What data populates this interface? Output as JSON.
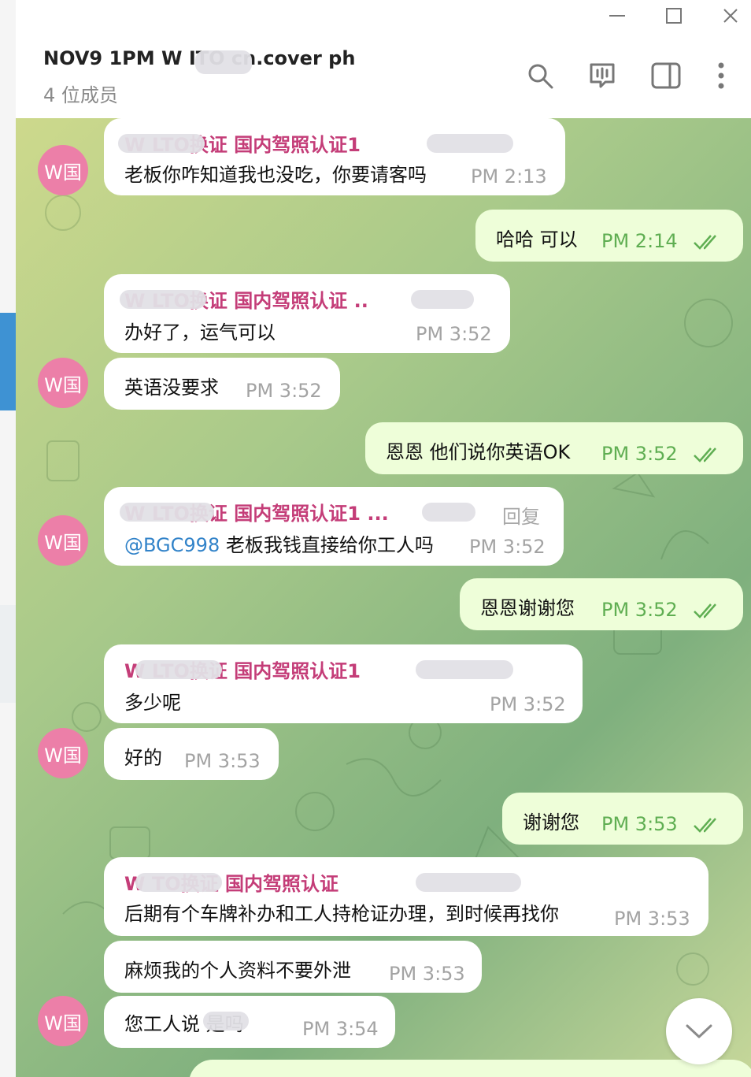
{
  "window": {
    "minimize": "—",
    "maximize": "☐",
    "close": "✕"
  },
  "header": {
    "title": "NOV9 1PM W      ITO cn.cover ph",
    "subtitle": "4 位成员",
    "icons": [
      "search-icon",
      "video-chat-icon",
      "sidebar-toggle-icon",
      "more-icon"
    ]
  },
  "avatar_label": "W国",
  "messages": [
    {
      "sender": "W         LTO换证 国内驾照认证1",
      "text": "老板你咋知道我也没吃，你要请客吗",
      "time": "PM 2:13"
    },
    {
      "text": "哈哈 可以",
      "time": "PM 2:14"
    },
    {
      "sender": "W          LTO换证 国内驾照认证       ..",
      "text": "办好了，运气可以",
      "time": "PM 3:52"
    },
    {
      "text": "英语没要求",
      "time": "PM 3:52"
    },
    {
      "text": "恩恩 他们说你英语OK",
      "time": "PM 3:52"
    },
    {
      "sender": "W         LTO换证 国内驾照认证1       ...",
      "reply_label": "回复",
      "mention": "@BGC998",
      "text": " 老板我钱直接给你工人吗",
      "time": "PM 3:52"
    },
    {
      "text": "恩恩谢谢您",
      "time": "PM 3:52"
    },
    {
      "sender": "W         LTO换证 国内驾照认证1",
      "text": "多少呢",
      "time": "PM 3:52"
    },
    {
      "text": "好的",
      "time": "PM 3:53"
    },
    {
      "text": "谢谢您",
      "time": "PM 3:53"
    },
    {
      "sender": "W         TO换证 国内驾照认证",
      "text": "后期有个车牌补办和工人持枪证办理，到时候再找你",
      "time": "PM 3:53"
    },
    {
      "text": "麻烦我的个人资料不要外泄",
      "time": "PM 3:53"
    },
    {
      "text": "您工人说       是吗",
      "time": "PM 3:54"
    }
  ]
}
